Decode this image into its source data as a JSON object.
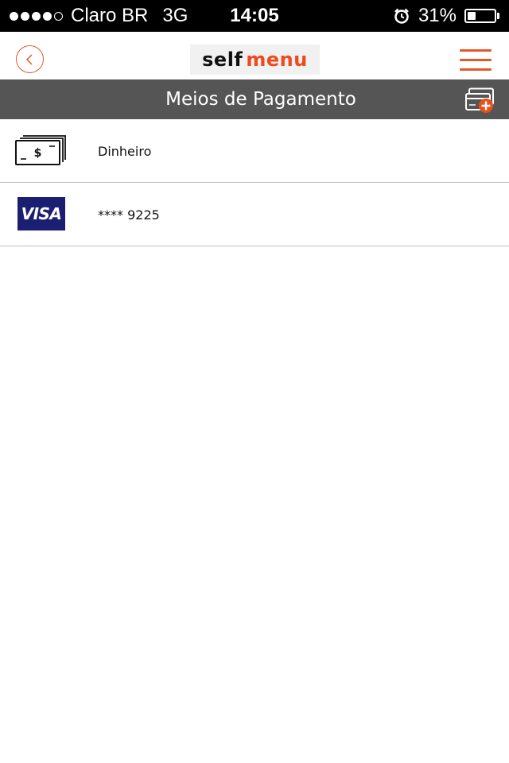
{
  "status_bar": {
    "carrier": "Claro BR",
    "network": "3G",
    "time": "14:05",
    "battery_percent_label": "31%",
    "battery_level": 0.31,
    "signal_bars_filled": 4,
    "signal_bars_total": 5,
    "icons": [
      "signal-dots-icon",
      "alarm-clock-icon",
      "battery-icon"
    ]
  },
  "header": {
    "logo_text_left": "self",
    "logo_text_right": "menu",
    "back_icon": "chevron-left-icon",
    "menu_icon": "hamburger-icon"
  },
  "title_bar": {
    "title": "Meios de Pagamento",
    "add_icon": "add-card-icon"
  },
  "payment_methods": [
    {
      "label": "Dinheiro",
      "icon": "cash-bills-icon"
    },
    {
      "label": "**** 9225",
      "icon": "visa-card-icon",
      "brand": "VISA"
    }
  ],
  "colors": {
    "accent": "#e25a2b",
    "logo_menu": "#ef4a1c",
    "title_bar_bg": "#555555",
    "visa_blue": "#1a1f71",
    "add_badge": "#e8501a"
  }
}
